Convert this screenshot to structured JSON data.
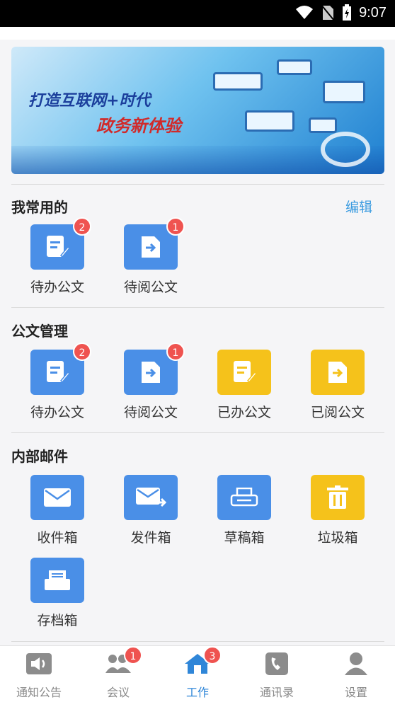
{
  "status": {
    "time": "9:07"
  },
  "header": {
    "title": ""
  },
  "banner": {
    "slogan_line1": "打造互联网+时代",
    "slogan_line2": "政务新体验"
  },
  "favorites": {
    "title": "我常用的",
    "edit_label": "编辑",
    "items": [
      {
        "label": "待办公文",
        "badge": "2",
        "icon": "doc-edit-icon",
        "color": "#4a8fe7"
      },
      {
        "label": "待阅公文",
        "badge": "1",
        "icon": "doc-forward-icon",
        "color": "#4a8fe7"
      }
    ]
  },
  "doc_management": {
    "title": "公文管理",
    "items": [
      {
        "label": "待办公文",
        "badge": "2",
        "icon": "doc-edit-icon",
        "color": "#4a8fe7"
      },
      {
        "label": "待阅公文",
        "badge": "1",
        "icon": "doc-forward-icon",
        "color": "#4a8fe7"
      },
      {
        "label": "已办公文",
        "icon": "doc-edit-icon",
        "color": "#f5c21b"
      },
      {
        "label": "已阅公文",
        "icon": "doc-forward-icon",
        "color": "#f5c21b"
      }
    ]
  },
  "internal_mail": {
    "title": "内部邮件",
    "items": [
      {
        "label": "收件箱",
        "icon": "envelope-icon",
        "color": "#4a8fe7"
      },
      {
        "label": "发件箱",
        "icon": "send-mail-icon",
        "color": "#4a8fe7"
      },
      {
        "label": "草稿箱",
        "icon": "printer-icon",
        "color": "#4a8fe7"
      },
      {
        "label": "垃圾箱",
        "icon": "trash-icon",
        "color": "#f5c21b"
      },
      {
        "label": "存档箱",
        "icon": "archive-icon",
        "color": "#4a8fe7"
      }
    ]
  },
  "tabbar": {
    "tabs": [
      {
        "label": "通知公告",
        "icon": "speaker-icon"
      },
      {
        "label": "会议",
        "icon": "people-icon",
        "badge": "1"
      },
      {
        "label": "工作",
        "icon": "home-icon",
        "badge": "3",
        "active": true
      },
      {
        "label": "通讯录",
        "icon": "phone-icon"
      },
      {
        "label": "设置",
        "icon": "person-icon"
      }
    ]
  },
  "colors": {
    "accent": "#2f86d8",
    "tile_blue": "#4a8fe7",
    "tile_yellow": "#f5c21b",
    "badge_red": "#ef5350"
  }
}
